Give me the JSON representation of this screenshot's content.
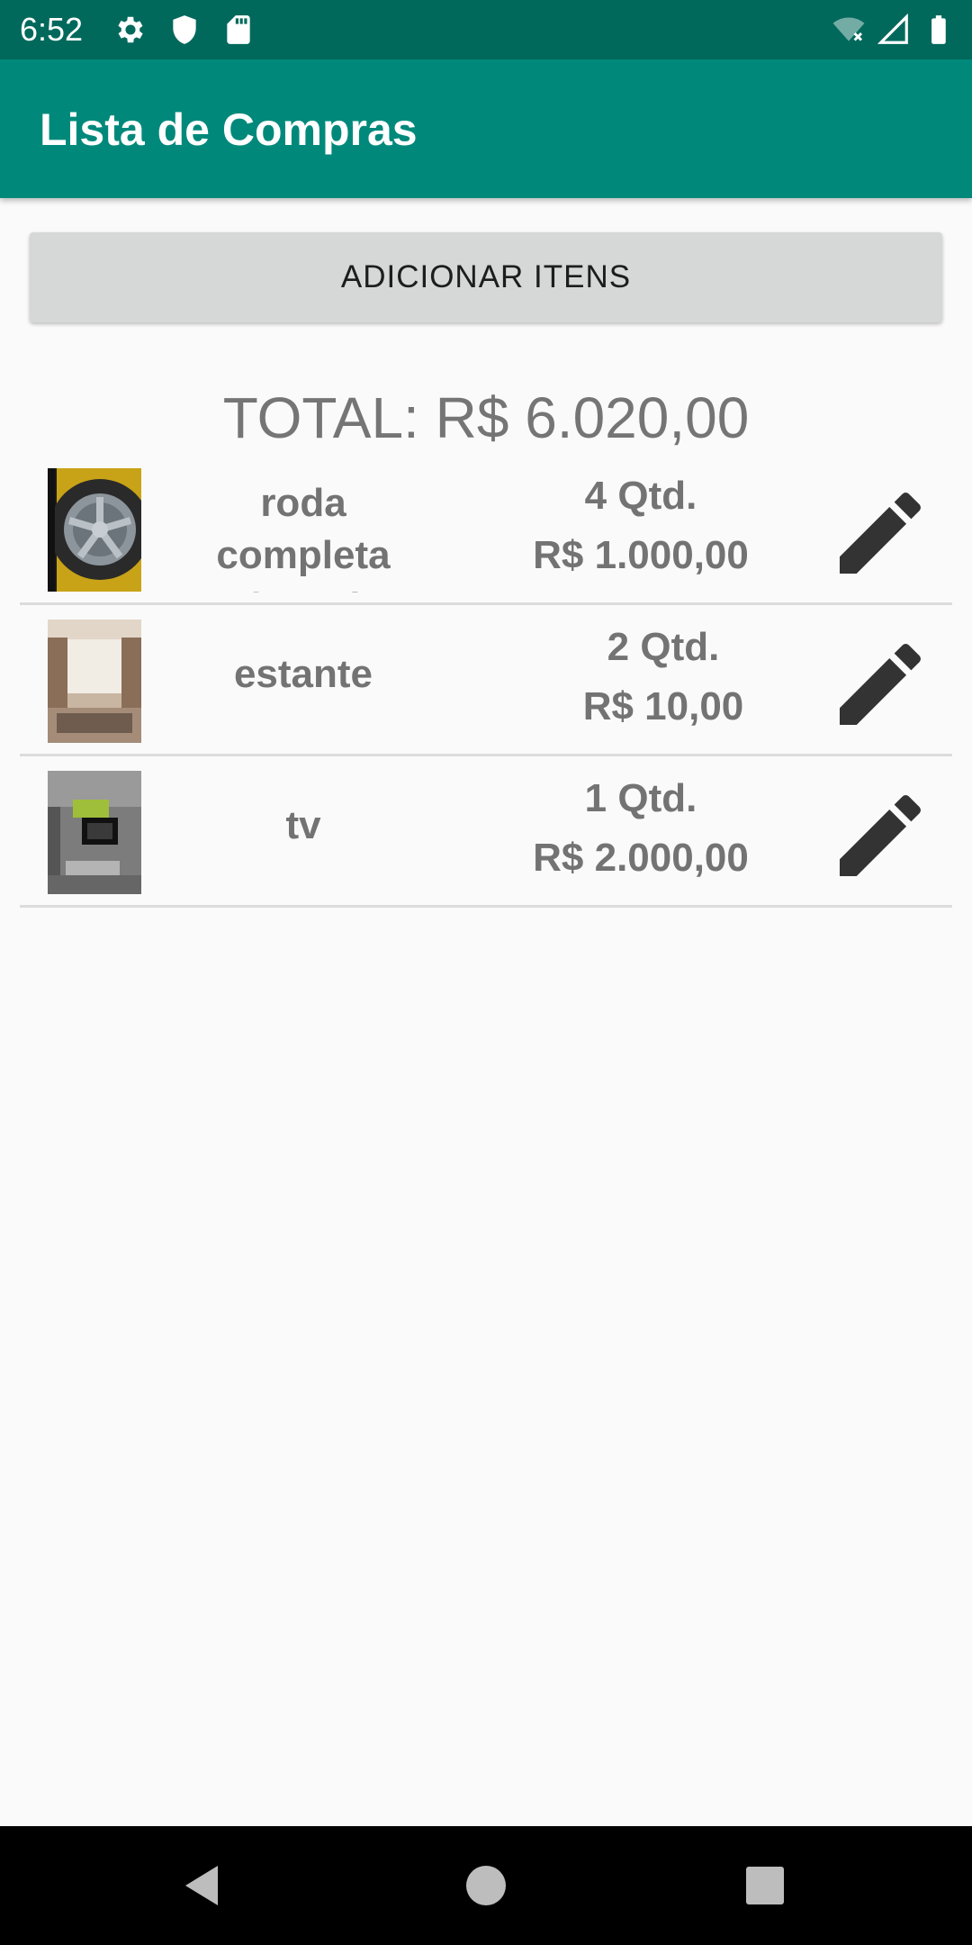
{
  "status_bar": {
    "time": "6:52",
    "left_icons": [
      "gear-icon",
      "shield-icon",
      "sd-card-icon"
    ],
    "right_icons": [
      "wifi-off-icon",
      "signal-icon",
      "battery-icon"
    ]
  },
  "app_bar": {
    "title": "Lista de Compras",
    "color": "#00897b",
    "status_color": "#01695c"
  },
  "add_button": {
    "label": "ADICIONAR ITENS"
  },
  "total": {
    "label": "TOTAL: R$ 6.020,00"
  },
  "items": [
    {
      "name": "roda completa ferrari",
      "qty": "4 Qtd.",
      "price": "R$ 1.000,00",
      "image": "wheel-photo",
      "edit_icon": "pencil-icon"
    },
    {
      "name": "estante",
      "qty": "2 Qtd.",
      "price": "R$ 10,00",
      "image": "living-room-photo",
      "edit_icon": "pencil-icon"
    },
    {
      "name": "tv",
      "qty": "1 Qtd.",
      "price": "R$ 2.000,00",
      "image": "tv-room-photo",
      "edit_icon": "pencil-icon"
    }
  ],
  "nav_bar": {
    "buttons": [
      "back-icon",
      "home-icon",
      "recents-icon"
    ]
  }
}
